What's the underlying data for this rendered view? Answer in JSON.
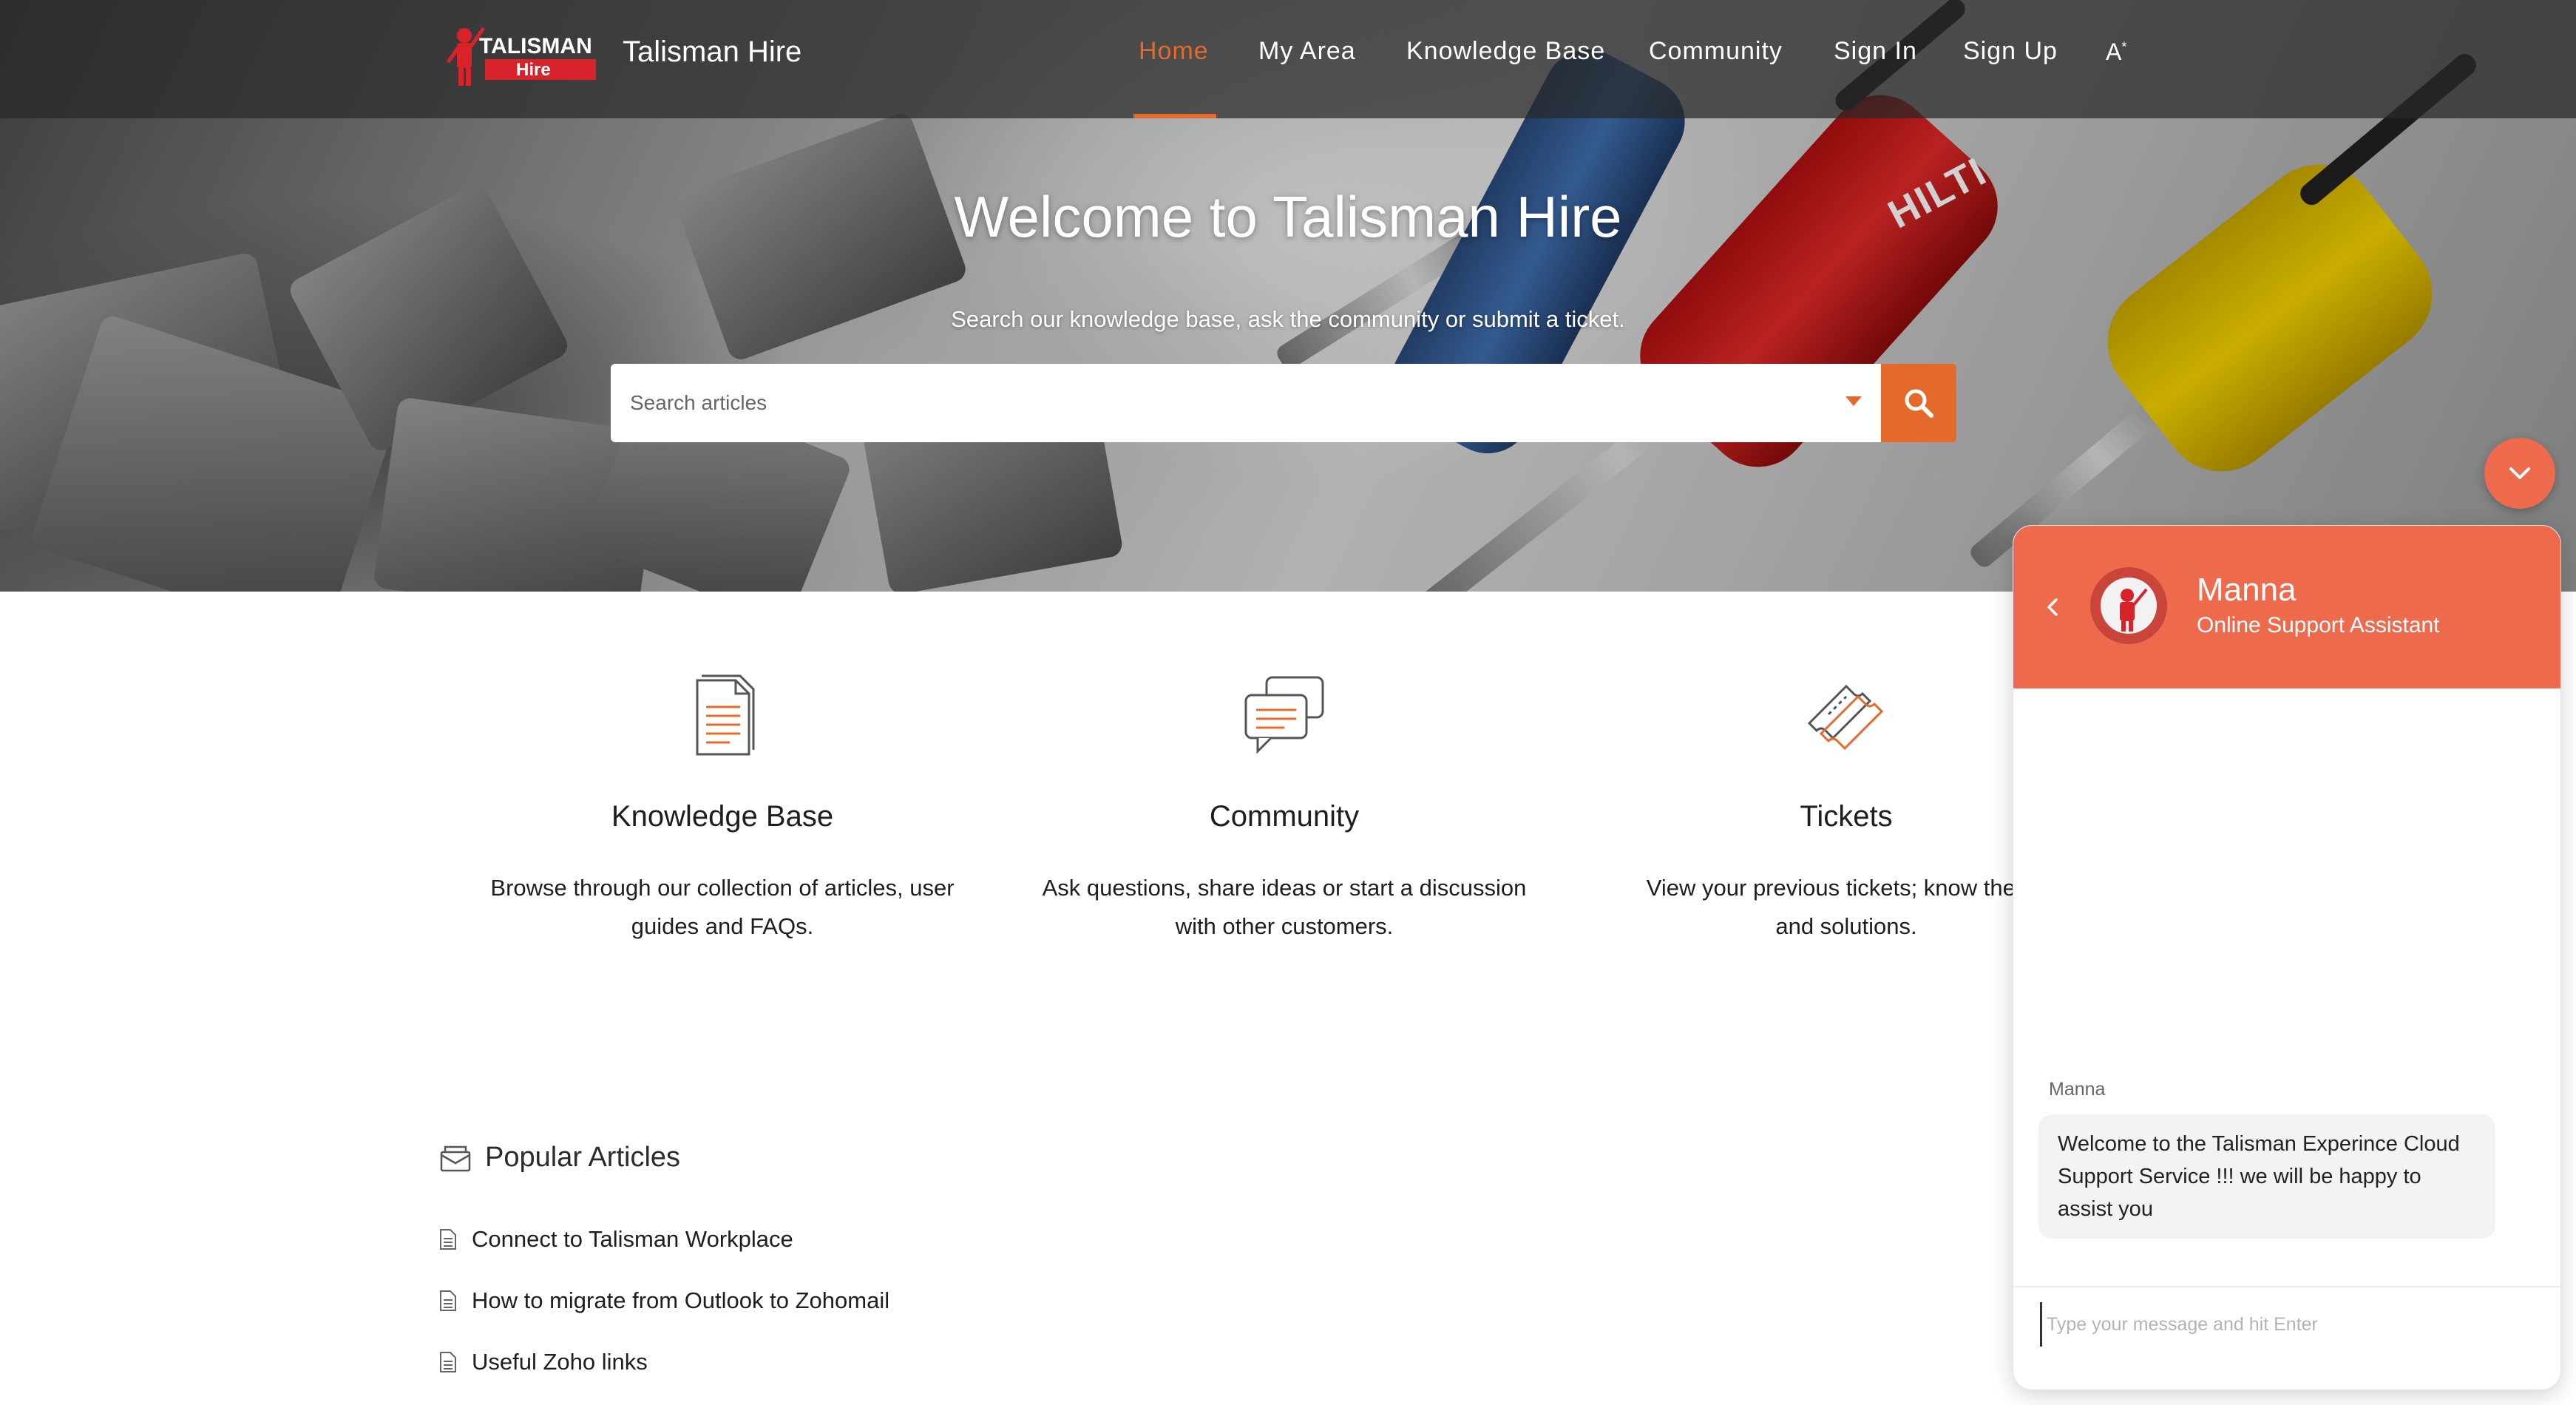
{
  "header": {
    "site_name": "Talisman Hire",
    "logo_text_top": "TALISMAN",
    "logo_text_bottom": "Hire",
    "nav": [
      {
        "label": "Home",
        "active": true
      },
      {
        "label": "My Area"
      },
      {
        "label": "Knowledge Base"
      },
      {
        "label": "Community"
      },
      {
        "label": "Sign In"
      },
      {
        "label": "Sign Up"
      }
    ],
    "accessibility_icon": "text-size-icon"
  },
  "hero": {
    "title": "Welcome to Talisman Hire",
    "subtitle": "Search our knowledge base, ask the community or submit a ticket.",
    "search_placeholder": "Search articles",
    "tool_brand": "HILTI"
  },
  "features": [
    {
      "icon": "document-icon",
      "title": "Knowledge Base",
      "desc_line1": "Browse through our collection of articles, user",
      "desc_line2": "guides and FAQs."
    },
    {
      "icon": "chat-bubbles-icon",
      "title": "Community",
      "desc_line1": "Ask questions, share ideas or start a discussion",
      "desc_line2": "with other customers."
    },
    {
      "icon": "ticket-icon",
      "title": "Tickets",
      "desc_line1": "View your previous tickets; know their s",
      "desc_line2": "and solutions."
    }
  ],
  "popular": {
    "title": "Popular Articles",
    "articles": [
      "Connect to Talisman Workplace",
      "How to migrate from Outlook to Zohomail",
      "Useful Zoho links"
    ]
  },
  "chat": {
    "agent_name": "Manna",
    "agent_role": "Online Support Assistant",
    "sender_label": "Manna",
    "message": "Welcome to the Talisman Experince Cloud Support Service !!! we will be happy to assist you",
    "input_placeholder": "Type your message and hit Enter"
  },
  "colors": {
    "accent": "#e46a2b",
    "chat_header": "#ee6a4d",
    "header_overlay": "#282828"
  }
}
